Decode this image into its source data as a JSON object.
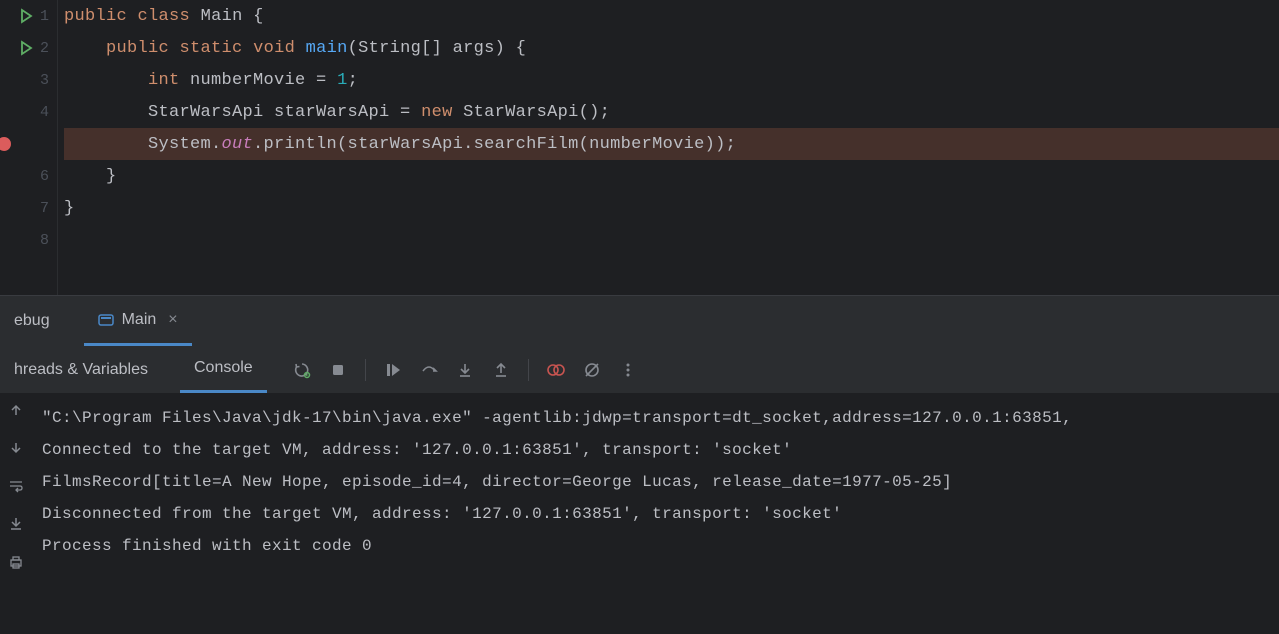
{
  "editor": {
    "lines": [
      {
        "num": "1",
        "run": true,
        "bp": false
      },
      {
        "num": "2",
        "run": true,
        "bp": false
      },
      {
        "num": "3",
        "run": false,
        "bp": false
      },
      {
        "num": "4",
        "run": false,
        "bp": false
      },
      {
        "num": "",
        "run": false,
        "bp": true
      },
      {
        "num": "6",
        "run": false,
        "bp": false
      },
      {
        "num": "7",
        "run": false,
        "bp": false
      },
      {
        "num": "8",
        "run": false,
        "bp": false
      }
    ],
    "code": {
      "l1": {
        "kw1": "public",
        "kw2": "class",
        "name": "Main",
        "brace": " {"
      },
      "l2": {
        "indent": "    ",
        "kw1": "public",
        "kw2": "static",
        "kw3": "void",
        "method": "main",
        "params": "(String[] args) {"
      },
      "l3": {
        "indent": "        ",
        "kw": "int",
        "rest": " numberMovie = ",
        "num": "1",
        "semi": ";"
      },
      "l4": {
        "indent": "        ",
        "text1": "StarWarsApi starWarsApi = ",
        "kw": "new",
        "text2": " StarWarsApi();"
      },
      "l5": {
        "indent": "        ",
        "text1": "System.",
        "field": "out",
        "text2": ".println(starWarsApi.searchFilm(numberMovie));"
      },
      "l6": {
        "indent": "    ",
        "text": "}"
      },
      "l7": {
        "text": "}"
      },
      "l8": {
        "text": ""
      }
    }
  },
  "debugPanel": {
    "debugLabel": "ebug",
    "mainTab": "Main",
    "threadsTab": "hreads & Variables",
    "consoleTab": "Console"
  },
  "console": {
    "line1": "\"C:\\Program Files\\Java\\jdk-17\\bin\\java.exe\" -agentlib:jdwp=transport=dt_socket,address=127.0.0.1:63851,",
    "line2": "Connected to the target VM, address: '127.0.0.1:63851', transport: 'socket'",
    "line3": "FilmsRecord[title=A New Hope, episode_id=4, director=George Lucas, release_date=1977-05-25]",
    "line4": "Disconnected from the target VM, address: '127.0.0.1:63851', transport: 'socket'",
    "line5": "",
    "line6": "Process finished with exit code 0"
  }
}
